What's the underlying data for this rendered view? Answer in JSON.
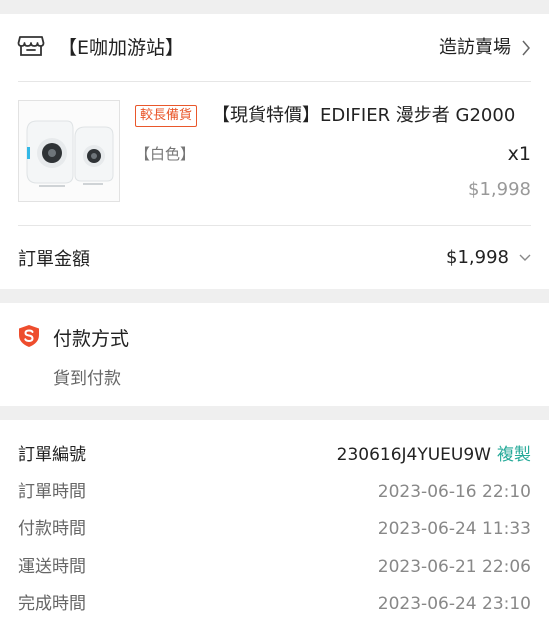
{
  "shop": {
    "name": "【E咖加游站】",
    "visit_label": "造訪賣場"
  },
  "product": {
    "badge": "較長備貨",
    "title": "【現貨特價】EDIFIER 漫步者 G2000",
    "variant": "【白色】",
    "quantity": "x1",
    "price": "$1,998"
  },
  "order_total": {
    "label": "訂單金額",
    "value": "$1,998"
  },
  "payment": {
    "title": "付款方式",
    "method": "貨到付款"
  },
  "order_info": {
    "order_number_label": "訂單編號",
    "order_number": "230616J4YUEU9W",
    "copy_label": "複製",
    "rows": [
      {
        "label": "訂單時間",
        "value": "2023-06-16 22:10"
      },
      {
        "label": "付款時間",
        "value": "2023-06-24 11:33"
      },
      {
        "label": "運送時間",
        "value": "2023-06-21 22:06"
      },
      {
        "label": "完成時間",
        "value": "2023-06-24 23:10"
      }
    ]
  },
  "colors": {
    "accent_orange": "#e9572b",
    "copy_teal": "#26aa99",
    "background": "#efefef"
  },
  "icons": {
    "shop": "shop-icon",
    "chevron_right": "chevron-right-icon",
    "chevron_down": "chevron-down-icon",
    "payment": "shield-s-icon"
  }
}
